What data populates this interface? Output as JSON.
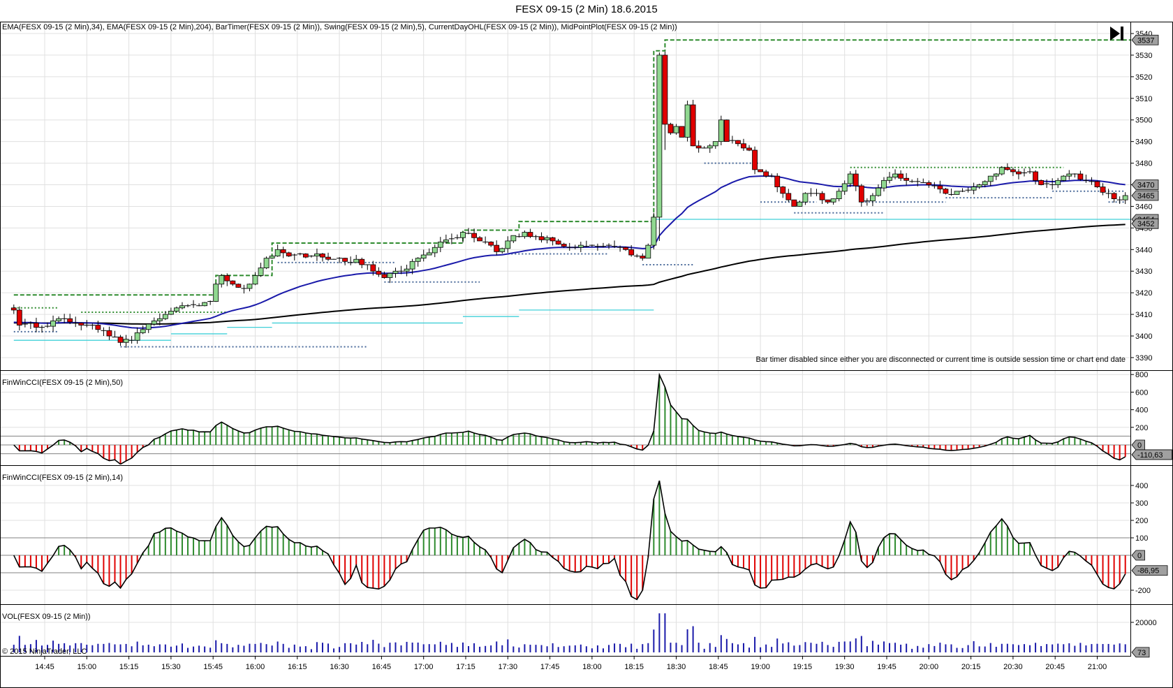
{
  "window": {
    "title": "FESX 09-15 (2 Min)  18.6.2015",
    "copyright": "© 2015 NinjaTrader, LLC",
    "bar_timer_message": "Bar timer disabled since either you are disconnected or current time is outside session time or chart end date"
  },
  "panels": {
    "price_label": "EMA(FESX 09-15 (2 Min),34), EMA(FESX 09-15 (2 Min),204), BarTimer(FESX 09-15 (2 Min)), Swing(FESX 09-15 (2 Min),5), CurrentDayOHL(FESX 09-15 (2 Min)), MidPointPlot(FESX 09-15 (2 Min))",
    "cci50_label": "FinWinCCI(FESX 09-15 (2 Min),50)",
    "cci14_label": "FinWinCCI(FESX 09-15 (2 Min),14)",
    "vol_label": "VOL(FESX 09-15 (2 Min))"
  },
  "colors": {
    "up": "#90d890",
    "down": "#e00000",
    "ema34": "#1a1aaa",
    "ema204": "#000000",
    "ohl": "#2e8b2e",
    "midpoint": "#40d0d8",
    "swing": "#4a6a9a",
    "volume": "#1a1aaa",
    "cci_up": "#2e8b2e",
    "cci_down": "#e00000",
    "tag": "#a0a0a0"
  },
  "chart_data": {
    "type": "candlestick",
    "instrument": "FESX 09-15",
    "bar_period_minutes": 2,
    "session_start": "14:34",
    "session_end": "21:10",
    "price_keypoints": [
      [
        "14:34",
        3412
      ],
      [
        "14:36",
        3405
      ],
      [
        "14:40",
        3406
      ],
      [
        "14:44",
        3404
      ],
      [
        "14:48",
        3407
      ],
      [
        "14:52",
        3408
      ],
      [
        "14:56",
        3406
      ],
      [
        "15:00",
        3405
      ],
      [
        "15:04",
        3403
      ],
      [
        "15:08",
        3400
      ],
      [
        "15:12",
        3397
      ],
      [
        "15:16",
        3398
      ],
      [
        "15:20",
        3403
      ],
      [
        "15:24",
        3407
      ],
      [
        "15:28",
        3410
      ],
      [
        "15:32",
        3413
      ],
      [
        "15:36",
        3414
      ],
      [
        "15:40",
        3414
      ],
      [
        "15:44",
        3416
      ],
      [
        "15:46",
        3424
      ],
      [
        "15:48",
        3428
      ],
      [
        "15:52",
        3424
      ],
      [
        "15:56",
        3422
      ],
      [
        "16:00",
        3428
      ],
      [
        "16:04",
        3436
      ],
      [
        "16:08",
        3440
      ],
      [
        "16:12",
        3437
      ],
      [
        "16:20",
        3437
      ],
      [
        "16:30",
        3436
      ],
      [
        "16:40",
        3433
      ],
      [
        "16:46",
        3427
      ],
      [
        "16:52",
        3430
      ],
      [
        "16:58",
        3436
      ],
      [
        "17:04",
        3441
      ],
      [
        "17:10",
        3445
      ],
      [
        "17:14",
        3448
      ],
      [
        "17:20",
        3444
      ],
      [
        "17:26",
        3439
      ],
      [
        "17:30",
        3444
      ],
      [
        "17:36",
        3448
      ],
      [
        "17:40",
        3446
      ],
      [
        "17:46",
        3444
      ],
      [
        "17:52",
        3441
      ],
      [
        "18:00",
        3442
      ],
      [
        "18:06",
        3442
      ],
      [
        "18:12",
        3440
      ],
      [
        "18:18",
        3436
      ],
      [
        "18:20",
        3442
      ],
      [
        "18:22",
        3455
      ],
      [
        "18:24",
        3530
      ],
      [
        "18:26",
        3498
      ],
      [
        "18:28",
        3494
      ],
      [
        "18:30",
        3497
      ],
      [
        "18:32",
        3492
      ],
      [
        "18:34",
        3507
      ],
      [
        "18:36",
        3488
      ],
      [
        "18:40",
        3487
      ],
      [
        "18:44",
        3490
      ],
      [
        "18:46",
        3500
      ],
      [
        "18:48",
        3490
      ],
      [
        "18:52",
        3489
      ],
      [
        "18:56",
        3486
      ],
      [
        "18:58",
        3477
      ],
      [
        "19:00",
        3476
      ],
      [
        "19:04",
        3474
      ],
      [
        "19:08",
        3466
      ],
      [
        "19:12",
        3460
      ],
      [
        "19:16",
        3466
      ],
      [
        "19:20",
        3466
      ],
      [
        "19:24",
        3462
      ],
      [
        "19:28",
        3467
      ],
      [
        "19:32",
        3475
      ],
      [
        "19:36",
        3462
      ],
      [
        "19:40",
        3465
      ],
      [
        "19:44",
        3472
      ],
      [
        "19:48",
        3475
      ],
      [
        "19:52",
        3472
      ],
      [
        "20:00",
        3470
      ],
      [
        "20:06",
        3466
      ],
      [
        "20:12",
        3467
      ],
      [
        "20:18",
        3470
      ],
      [
        "20:22",
        3474
      ],
      [
        "20:26",
        3478
      ],
      [
        "20:30",
        3476
      ],
      [
        "20:36",
        3476
      ],
      [
        "20:40",
        3470
      ],
      [
        "20:44",
        3470
      ],
      [
        "20:48",
        3474
      ],
      [
        "20:52",
        3475
      ],
      [
        "20:56",
        3472
      ],
      [
        "21:00",
        3469
      ],
      [
        "21:04",
        3466
      ],
      [
        "21:08",
        3463
      ],
      [
        "21:10",
        3465
      ]
    ],
    "ema_periods": [
      34,
      204
    ],
    "ema204_seed": 3406,
    "ohl_high_levels": [
      [
        "14:34",
        "15:46",
        3419
      ],
      [
        "15:46",
        "16:06",
        3428
      ],
      [
        "16:06",
        "17:14",
        3443
      ],
      [
        "17:14",
        "17:34",
        3449
      ],
      [
        "17:34",
        "18:22",
        3453
      ],
      [
        "18:22",
        "18:26",
        3532
      ],
      [
        "18:26",
        "21:12",
        3537
      ]
    ],
    "midpoint_levels": [
      [
        "14:34",
        "15:30",
        3398
      ],
      [
        "15:30",
        "15:50",
        3401
      ],
      [
        "15:50",
        "16:06",
        3404
      ],
      [
        "16:06",
        "17:14",
        3406
      ],
      [
        "17:14",
        "17:34",
        3409
      ],
      [
        "17:34",
        "18:22",
        3412
      ],
      [
        "18:22",
        "21:12",
        3454
      ]
    ],
    "swing_levels": [
      [
        "14:34",
        "14:50",
        3413,
        "high"
      ],
      [
        "14:34",
        "14:50",
        3402,
        "low"
      ],
      [
        "14:58",
        "15:50",
        3411,
        "high"
      ],
      [
        "15:12",
        "16:40",
        3395,
        "low"
      ],
      [
        "16:08",
        "16:50",
        3434,
        "low"
      ],
      [
        "16:46",
        "17:20",
        3425,
        "low"
      ],
      [
        "17:30",
        "18:06",
        3438,
        "low"
      ],
      [
        "18:18",
        "18:36",
        3433,
        "low"
      ],
      [
        "18:40",
        "19:00",
        3480,
        "low"
      ],
      [
        "19:00",
        "19:20",
        3462,
        "low"
      ],
      [
        "19:12",
        "19:44",
        3457,
        "low"
      ],
      [
        "19:32",
        "20:48",
        3478,
        "high"
      ],
      [
        "19:36",
        "20:06",
        3462,
        "low"
      ],
      [
        "20:06",
        "20:44",
        3464,
        "low"
      ],
      [
        "20:44",
        "21:10",
        3467,
        "low"
      ],
      [
        "21:04",
        "21:10",
        3462,
        "low"
      ]
    ],
    "price_axis": {
      "ticks": [
        3540,
        3530,
        3520,
        3510,
        3500,
        3490,
        3480,
        3470,
        3460,
        3450,
        3440,
        3430,
        3420,
        3410,
        3400,
        3390
      ],
      "range": [
        3386,
        3545
      ]
    },
    "price_tags": [
      "3537",
      "3470",
      "3465",
      "3454",
      "3452"
    ],
    "cci50_axis": {
      "ticks": [
        800,
        600,
        400,
        200
      ],
      "tags": [
        "0",
        "-110,63"
      ],
      "ref_lines": [
        100,
        0,
        -100
      ]
    },
    "cci14_axis": {
      "ticks": [
        400,
        300,
        200,
        100,
        -200
      ],
      "tags": [
        "0",
        "-86,95"
      ],
      "ref_lines": [
        100,
        0,
        -100
      ]
    },
    "vol_axis": {
      "ticks": [
        20000
      ],
      "tags": [
        "73"
      ]
    },
    "time_labels": [
      "14:45",
      "15:00",
      "15:15",
      "15:30",
      "15:45",
      "16:00",
      "16:15",
      "16:30",
      "16:45",
      "17:00",
      "17:15",
      "17:30",
      "17:45",
      "18:00",
      "18:15",
      "18:30",
      "18:45",
      "19:00",
      "19:15",
      "19:30",
      "19:45",
      "20:00",
      "20:15",
      "20:30",
      "20:45",
      "21:00"
    ]
  }
}
